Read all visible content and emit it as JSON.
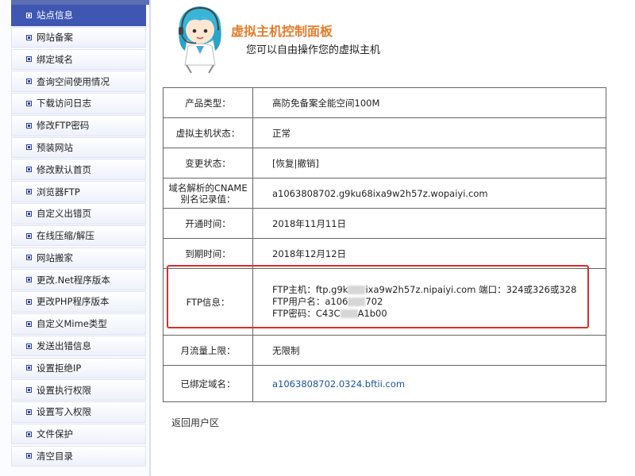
{
  "sidebar": {
    "items": [
      {
        "label": "站点信息",
        "active": true
      },
      {
        "label": "网站备案"
      },
      {
        "label": "绑定域名"
      },
      {
        "label": "查询空间使用情况"
      },
      {
        "label": "下载访问日志"
      },
      {
        "label": "修改FTP密码"
      },
      {
        "label": "预装网站"
      },
      {
        "label": "修改默认首页"
      },
      {
        "label": "浏览器FTP"
      },
      {
        "label": "自定义出错页"
      },
      {
        "label": "在线压缩/解压"
      },
      {
        "label": "网站搬家"
      },
      {
        "label": "更改.Net程序版本"
      },
      {
        "label": "更改PHP程序版本"
      },
      {
        "label": "自定义Mime类型"
      },
      {
        "label": "发送出错信息"
      },
      {
        "label": "设置拒绝IP"
      },
      {
        "label": "设置执行权限"
      },
      {
        "label": "设置写入权限"
      },
      {
        "label": "文件保护"
      },
      {
        "label": "清空目录"
      }
    ]
  },
  "header": {
    "title": "虚拟主机控制面板",
    "subtitle": "您可以自由操作您的虚拟主机"
  },
  "info": {
    "product_type": {
      "label": "产品类型：",
      "value": "高防免备案全能空间100M"
    },
    "host_status": {
      "label": "虚拟主机状态：",
      "value": "正常"
    },
    "change_status": {
      "label": "变更状态：",
      "value": "[恢复|撤销]"
    },
    "cname": {
      "label_line1": "域名解析的CNAME",
      "label_line2": "别名记录值：",
      "value": "a1063808702.g9ku68ixa9w2h57z.wopaiyi.com"
    },
    "open_time": {
      "label": "开通时间：",
      "value": "2018年11月11日"
    },
    "expire_time": {
      "label": "到期时间：",
      "value": "2018年12月12日"
    },
    "ftp": {
      "label": "FTP信息：",
      "host_prefix": "FTP主机：ftp.g9k",
      "host_suffix": "ixa9w2h57z.nipaiyi.com 端口：324或326或328",
      "user_prefix": "FTP用户名：a106",
      "user_suffix": "702",
      "pass_prefix": "FTP密码：C43C",
      "pass_suffix": "A1b00"
    },
    "traffic": {
      "label": "月流量上限：",
      "value": "无限制"
    },
    "bound_domain": {
      "label": "已绑定域名：",
      "value": "a1063808702.0324.bftii.com"
    }
  },
  "footer": {
    "back_label": "返回用户区"
  },
  "colors": {
    "accent": "#3f57b3",
    "title": "#e47d2c",
    "highlight": "#d82e2e",
    "link": "#1f4fa8"
  }
}
